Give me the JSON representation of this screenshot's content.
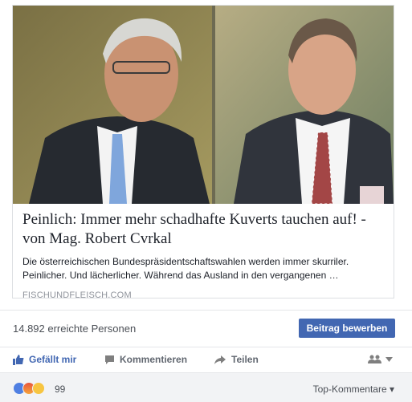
{
  "card": {
    "title": "Peinlich: Immer mehr schadhafte Kuverts tauchen auf! - von Mag. Robert Cvrkal",
    "description": "Die österreichischen Bundespräsidentschaftswahlen werden immer skurriler. Peinlicher. Und lächerlicher. Während das Ausland in den vergangenen …",
    "domain": "FISCHUNDFLEISCH.COM"
  },
  "insights": {
    "reach_text": "14.892 erreichte Personen",
    "boost_label": "Beitrag bewerben"
  },
  "actions": {
    "like_label": "Gefällt mir",
    "comment_label": "Kommentieren",
    "share_label": "Teilen"
  },
  "reactions": {
    "types": [
      "like",
      "angry",
      "haha"
    ],
    "count": "99",
    "sort_label": "Top-Kommentare"
  },
  "colors": {
    "accent": "#4267b2",
    "muted": "#90949c",
    "bar_bg": "#f2f3f5"
  }
}
